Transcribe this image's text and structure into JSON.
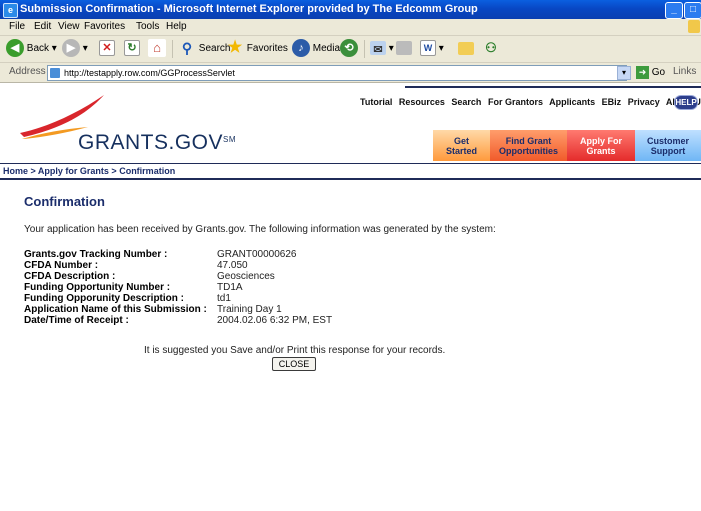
{
  "window": {
    "title": "Submission Confirmation - Microsoft Internet Explorer provided by The Edcomm Group",
    "minimize_glyph": "_",
    "maximize_glyph": "□"
  },
  "menu": [
    "File",
    "Edit",
    "View",
    "Favorites",
    "Tools",
    "Help"
  ],
  "toolbar": {
    "back": "Back",
    "search": "Search",
    "favorites": "Favorites",
    "media": "Media"
  },
  "address": {
    "label": "Address",
    "url": "http://testapply.row.com/GGProcessServlet",
    "go": "Go",
    "links": "Links"
  },
  "site": {
    "logo": "GRANTS.GOV",
    "logo_mark": "SM",
    "top_nav": [
      "Tutorial",
      "Resources",
      "Search",
      "For Grantors",
      "Applicants",
      "EBiz",
      "Privacy",
      "About Us"
    ],
    "help": "HELP",
    "tabs": [
      {
        "line1": "Get",
        "line2": "Started"
      },
      {
        "line1": "Find Grant",
        "line2": "Opportunities"
      },
      {
        "line1": "Apply For",
        "line2": "Grants"
      },
      {
        "line1": "Customer",
        "line2": "Support"
      }
    ],
    "breadcrumb": "Home > Apply for Grants > Confirmation"
  },
  "content": {
    "heading": "Confirmation",
    "intro": "Your application has been received by Grants.gov. The following information was generated by the system:",
    "fields": [
      {
        "label": "Grants.gov Tracking Number :",
        "value": "GRANT00000626"
      },
      {
        "label": "CFDA Number :",
        "value": "47.050"
      },
      {
        "label": "CFDA Description :",
        "value": "Geosciences"
      },
      {
        "label": "Funding Opportunity Number :",
        "value": "TD1A"
      },
      {
        "label": "Funding Opporunity Description :",
        "value": "td1"
      },
      {
        "label": "Application Name of this Submission :",
        "value": "Training Day 1"
      },
      {
        "label": "Date/Time of Receipt :",
        "value": "2004.02.06 6:32 PM, EST"
      }
    ],
    "suggestion": "It is suggested you Save and/or Print this response for your records.",
    "close_button": "CLOSE"
  },
  "colors": {
    "title_bar": "#0847c4",
    "navy": "#1b2d6b",
    "swoosh_red": "#d9262c",
    "swoosh_orange": "#f39a22"
  }
}
